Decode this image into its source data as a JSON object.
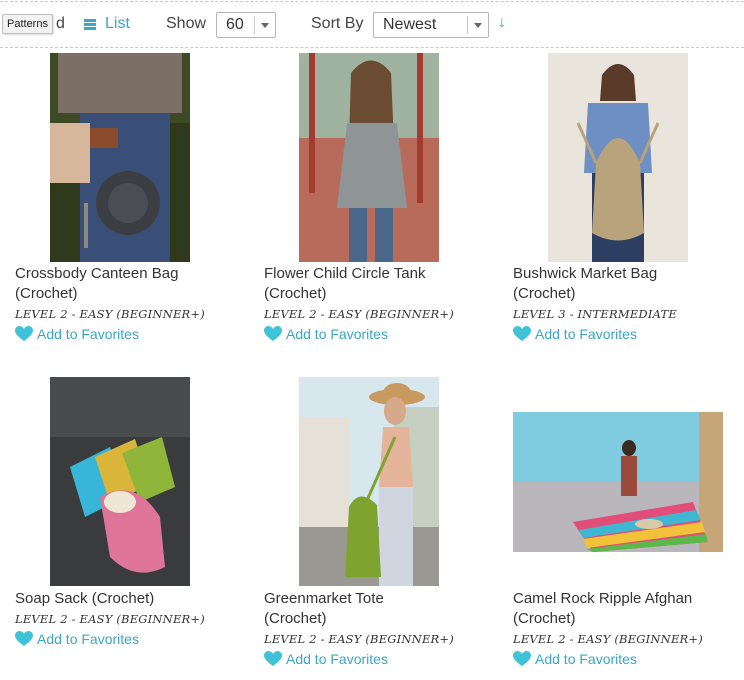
{
  "toolbar": {
    "tooltip": "Patterns",
    "grid_label_tail": "d",
    "list_label": "List",
    "show_label": "Show",
    "show_value": "60",
    "sort_label": "Sort By",
    "sort_value": "Newest",
    "sort_direction_glyph": "↓"
  },
  "colors": {
    "accent": "#3aa7c4",
    "text": "#333333"
  },
  "favorites_label": "Add to Favorites",
  "products": [
    {
      "title_line1": "Crossbody Canteen Bag",
      "title_line2": "(Crochet)",
      "level": "LEVEL 2 - EASY (BEGINNER+)"
    },
    {
      "title_line1": "Flower Child Circle Tank",
      "title_line2": "(Crochet)",
      "level": "LEVEL 2 - EASY (BEGINNER+)"
    },
    {
      "title_line1": "Bushwick Market Bag",
      "title_line2": "(Crochet)",
      "level": "LEVEL 3 - INTERMEDIATE"
    },
    {
      "title_line1": "Soap Sack (Crochet)",
      "title_line2": "",
      "level": "LEVEL 2 - EASY (BEGINNER+)"
    },
    {
      "title_line1": "Greenmarket Tote",
      "title_line2": "(Crochet)",
      "level": "LEVEL 2 - EASY (BEGINNER+)"
    },
    {
      "title_line1": "Camel Rock Ripple Afghan",
      "title_line2": "(Crochet)",
      "level": "LEVEL 2 - EASY (BEGINNER+)"
    }
  ]
}
